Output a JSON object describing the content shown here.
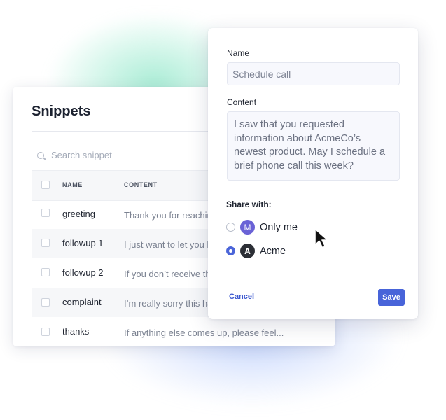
{
  "snippets": {
    "title": "Snippets",
    "search_placeholder": "Search snippet",
    "columns": {
      "name": "NAME",
      "content": "CONTENT"
    },
    "rows": [
      {
        "name": "greeting",
        "content": "Thank you for reaching out..."
      },
      {
        "name": "followup 1",
        "content": "I just want to let you know..."
      },
      {
        "name": "followup 2",
        "content": "If you don’t receive this..."
      },
      {
        "name": "complaint",
        "content": "I’m really sorry this happened..."
      },
      {
        "name": "thanks",
        "content": "If anything else comes up, please feel..."
      }
    ]
  },
  "editor": {
    "name_label": "Name",
    "name_value": "Schedule call",
    "content_label": "Content",
    "content_value": "I saw that you requested information about AcmeCo’s newest product. May I schedule a brief phone call this week?",
    "share_label": "Share with:",
    "options": [
      {
        "avatar": "M",
        "label": "Only me",
        "selected": false
      },
      {
        "avatar": "A",
        "label": "Acme",
        "selected": true
      }
    ],
    "cancel_label": "Cancel",
    "save_label": "Save"
  },
  "colors": {
    "accent": "#4864d9",
    "avatar_m": "#6a62d6",
    "avatar_a": "#2c2f36"
  }
}
